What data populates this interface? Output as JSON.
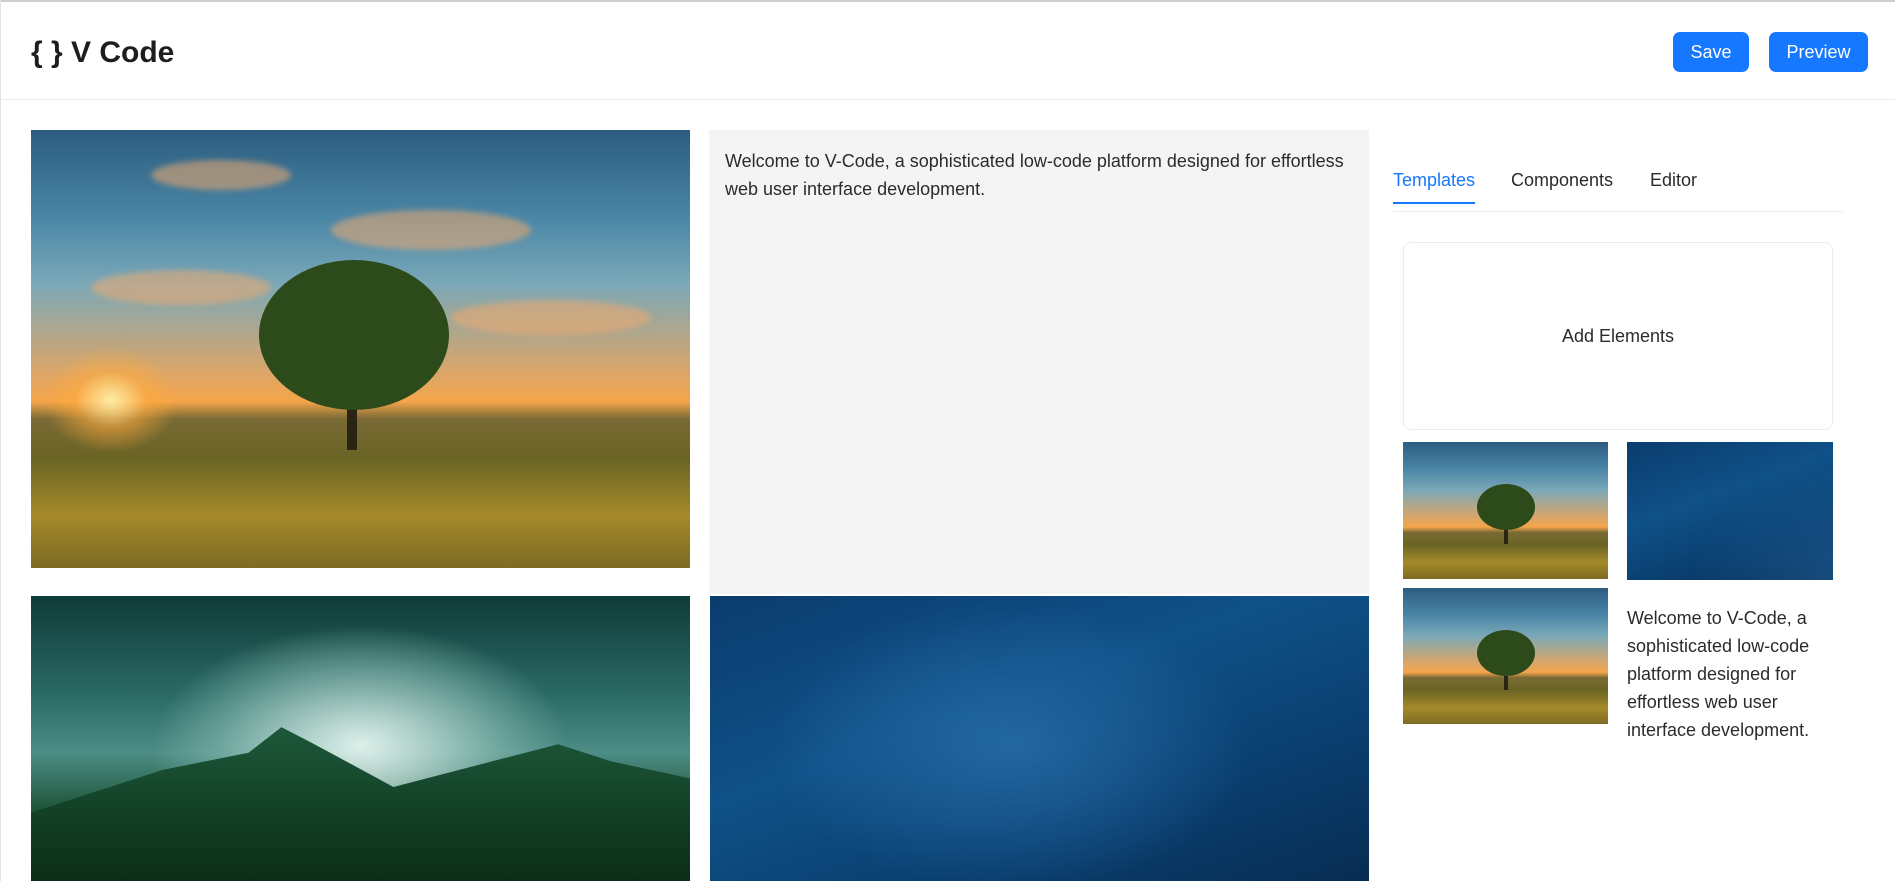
{
  "app": {
    "title": "{ } V Code"
  },
  "toolbar": {
    "save_label": "Save",
    "preview_label": "Preview"
  },
  "canvas": {
    "welcome_text": "Welcome to V-Code, a sophisticated low-code platform designed for effortless web user interface development."
  },
  "panel": {
    "tabs": [
      {
        "label": "Templates",
        "active": true
      },
      {
        "label": "Components",
        "active": false
      },
      {
        "label": "Editor",
        "active": false
      }
    ],
    "add_elements_label": "Add Elements",
    "template_text": "Welcome to V-Code, a sophisticated low-code platform designed for effortless web user interface development."
  },
  "colors": {
    "accent": "#1677ff",
    "text_block_bg": "#f4f4f4"
  },
  "icons": [
    "curly-braces-icon"
  ]
}
